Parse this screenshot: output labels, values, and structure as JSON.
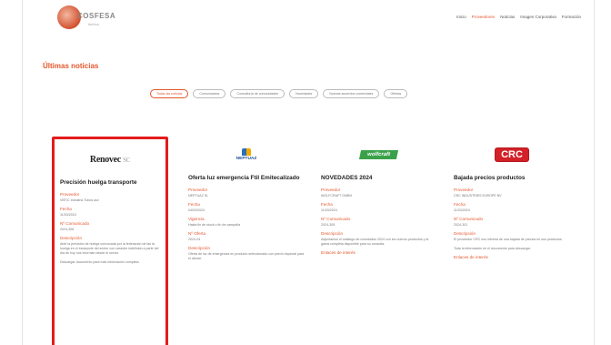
{
  "header": {
    "logo_text": "COSFESA",
    "logo_sub": "ibérica",
    "nav": [
      {
        "label": "Inicio",
        "active": false
      },
      {
        "label": "Proveedores",
        "active": true
      },
      {
        "label": "Noticias",
        "active": false
      },
      {
        "label": "Imagen Corporativa",
        "active": false
      },
      {
        "label": "Formación",
        "active": false
      }
    ]
  },
  "section_title": "Últimas noticias",
  "filters": [
    {
      "label": "Todas las noticias",
      "active": true
    },
    {
      "label": "Comunicados",
      "active": false
    },
    {
      "label": "Consultoría de comunidades",
      "active": false
    },
    {
      "label": "Novedades",
      "active": false
    },
    {
      "label": "Nuevas acuerdos comerciales",
      "active": false
    },
    {
      "label": "Ofertas",
      "active": false
    }
  ],
  "cards": [
    {
      "brand": "Renovec",
      "title": "Precisión huelga transporte",
      "fields": [
        {
          "label": "Proveedor",
          "value": "VBTIC Industria Tubos aux"
        },
        {
          "label": "Fecha",
          "value": "11/03/2024"
        },
        {
          "label": "Nº Comunicado",
          "value": "2024-306"
        },
        {
          "label": "Descripción",
          "value": "Ante la previsión de huelga convocada por la federación de las la huelga en el transporte del sector con carácter indefinido a partir del día de hoy nos informan desde el sector."
        },
        {
          "label": "",
          "value": "Descargar documento para más información completa."
        }
      ]
    },
    {
      "brand": "NEPTUAZ",
      "title": "Oferta luz emergencia Ftil Emitecalizado",
      "fields": [
        {
          "label": "Proveedor",
          "value": "NEPTUAZ SL"
        },
        {
          "label": "Fecha",
          "value": "04/03/2024"
        },
        {
          "label": "Vigencia",
          "value": "Hasta fin de stock o fin de campaña"
        },
        {
          "label": "Nº Oferta",
          "value": "2024-04"
        },
        {
          "label": "Descripción",
          "value": "Oferta de luz de emergencia en producto seleccionado con precio especial para el cliente."
        }
      ]
    },
    {
      "brand": "wolfcraft",
      "title": "NOVEDADES 2024",
      "fields": [
        {
          "label": "Proveedor",
          "value": "WOLFCRAFT GMBH"
        },
        {
          "label": "Fecha",
          "value": "11/03/2024"
        },
        {
          "label": "Nº Comunicado",
          "value": "2024-305"
        },
        {
          "label": "Descripción",
          "value": "Adjuntamos el catálogo de novedades 2024 con los nuevos productos y la gama completa disponible para su consulta."
        },
        {
          "label": "Enlaces de interés",
          "value": ""
        }
      ]
    },
    {
      "brand": "CRC",
      "title": "Bajada precios productos",
      "fields": [
        {
          "label": "Proveedor",
          "value": "CRC INDUSTRIES EUROPE BV"
        },
        {
          "label": "Fecha",
          "value": "11/03/2024"
        },
        {
          "label": "Nº Comunicado",
          "value": "2024-301"
        },
        {
          "label": "Descripción",
          "value": "El proveedor CRC nos informa de una bajada de precios en sus productos."
        },
        {
          "label": "",
          "value": "Toda la información en el documento para descargar."
        },
        {
          "label": "Enlaces de interés",
          "value": ""
        }
      ]
    }
  ]
}
